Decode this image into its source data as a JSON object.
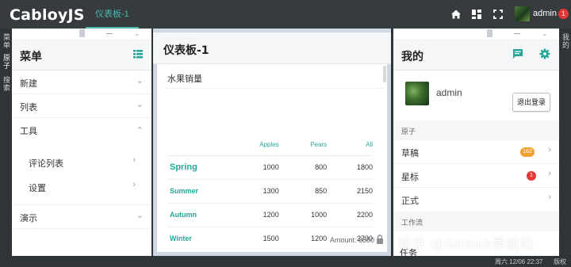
{
  "app": {
    "logo": "CabloyJS",
    "active_tab": "仪表板-1",
    "user": "admin",
    "notification_count": "1",
    "accent_color": "#26a69a"
  },
  "sidebar_left_labels": [
    "菜单",
    "原子",
    "搜索"
  ],
  "sidebar_right_label": "我的",
  "left_panel": {
    "title": "菜单",
    "items": [
      {
        "label": "新建"
      },
      {
        "label": "列表"
      },
      {
        "label": "工具"
      }
    ],
    "sub_items": [
      {
        "label": "评论列表"
      },
      {
        "label": "设置"
      }
    ],
    "last_item": {
      "label": "演示"
    }
  },
  "middle_panel": {
    "title": "仪表板-1",
    "card_title": "水果销量",
    "table": {
      "columns": [
        "Apples",
        "Pears",
        "All"
      ],
      "rows": [
        {
          "season": "Spring",
          "values": [
            "1000",
            "800",
            "1800"
          ]
        },
        {
          "season": "Summer",
          "values": [
            "1300",
            "850",
            "2150"
          ]
        },
        {
          "season": "Autumn",
          "values": [
            "1200",
            "1000",
            "2200"
          ]
        },
        {
          "season": "Winter",
          "values": [
            "1500",
            "1200",
            "2700"
          ]
        }
      ]
    },
    "amount": "Amount: 8850"
  },
  "right_panel": {
    "title": "我的",
    "username": "admin",
    "logout_label": "退出登录",
    "section_atoms": "原子",
    "atom_items": [
      {
        "label": "草稿",
        "badge": "162",
        "badge_color": "#f0a030"
      },
      {
        "label": "星标",
        "badge": "1",
        "badge_color": "#e53935"
      },
      {
        "label": "正式",
        "badge": ""
      }
    ],
    "section_flow": "工作流",
    "flow_item": "任务"
  },
  "watermark": "知乎 @Github导航站",
  "status": {
    "time": "周六 12/06 22:37",
    "copyright": "版权"
  }
}
